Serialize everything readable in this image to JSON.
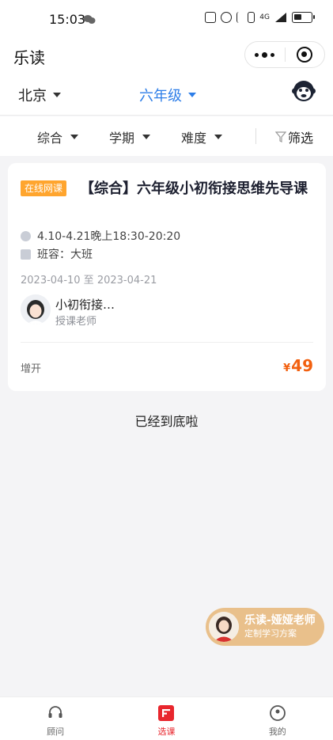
{
  "status_bar": {
    "time": "15:03",
    "network": "4G"
  },
  "header": {
    "title": "乐读"
  },
  "filters": {
    "city": "北京",
    "grade": "六年级",
    "sort": "综合",
    "term": "学期",
    "difficulty": "难度",
    "screen": "筛选"
  },
  "course": {
    "tag": "在线网课",
    "title": "【综合】六年级小初衔接思维先导课",
    "time": "4.10-4.21晚上18:30-20:20",
    "class_type": "班容：大班",
    "date_range": "2023-04-10 至 2023-04-21",
    "teacher_name": "小初衔接…",
    "teacher_role": "授课老师",
    "seats": "增开",
    "price_currency": "¥",
    "price": "49"
  },
  "end_text": "已经到底啦",
  "consult": {
    "title": "乐读-娅娅老师",
    "subtitle": "定制学习方案"
  },
  "tabbar": {
    "items": [
      {
        "label": "顾问"
      },
      {
        "label": "选课"
      },
      {
        "label": "我的"
      }
    ]
  },
  "colors": {
    "accent_blue": "#2d7ee8",
    "price_orange": "#f2600f",
    "tag_orange": "#ffa52e",
    "tab_active_red": "#e8262d",
    "consult_gold": "#e9c08b"
  }
}
